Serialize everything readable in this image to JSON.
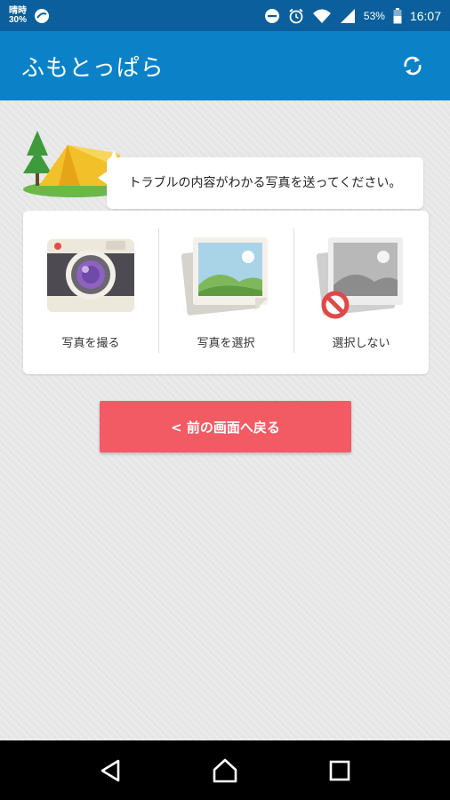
{
  "status_bar": {
    "temperature_top": "晴時",
    "temperature": "30%",
    "battery_percent": "53%",
    "time": "16:07",
    "icons": [
      "dnd-icon",
      "alarm-icon",
      "wifi-icon",
      "signal-icon",
      "battery-icon"
    ]
  },
  "app_bar": {
    "title": "ふもとっぱら",
    "action_icon": "refresh-icon",
    "color": "#0b82c8"
  },
  "prompt": {
    "message": "トラブルの内容がわかる写真を送ってください。"
  },
  "options": [
    {
      "label": "写真を撮る",
      "icon": "camera-icon"
    },
    {
      "label": "写真を選択",
      "icon": "photo-icon"
    },
    {
      "label": "選択しない",
      "icon": "no-photo-icon"
    }
  ],
  "back_button": {
    "label": "< 前の画面へ戻る",
    "color": "#f25a64"
  },
  "nav_bar": {
    "icons": [
      "back-icon",
      "home-icon",
      "recents-icon"
    ]
  }
}
